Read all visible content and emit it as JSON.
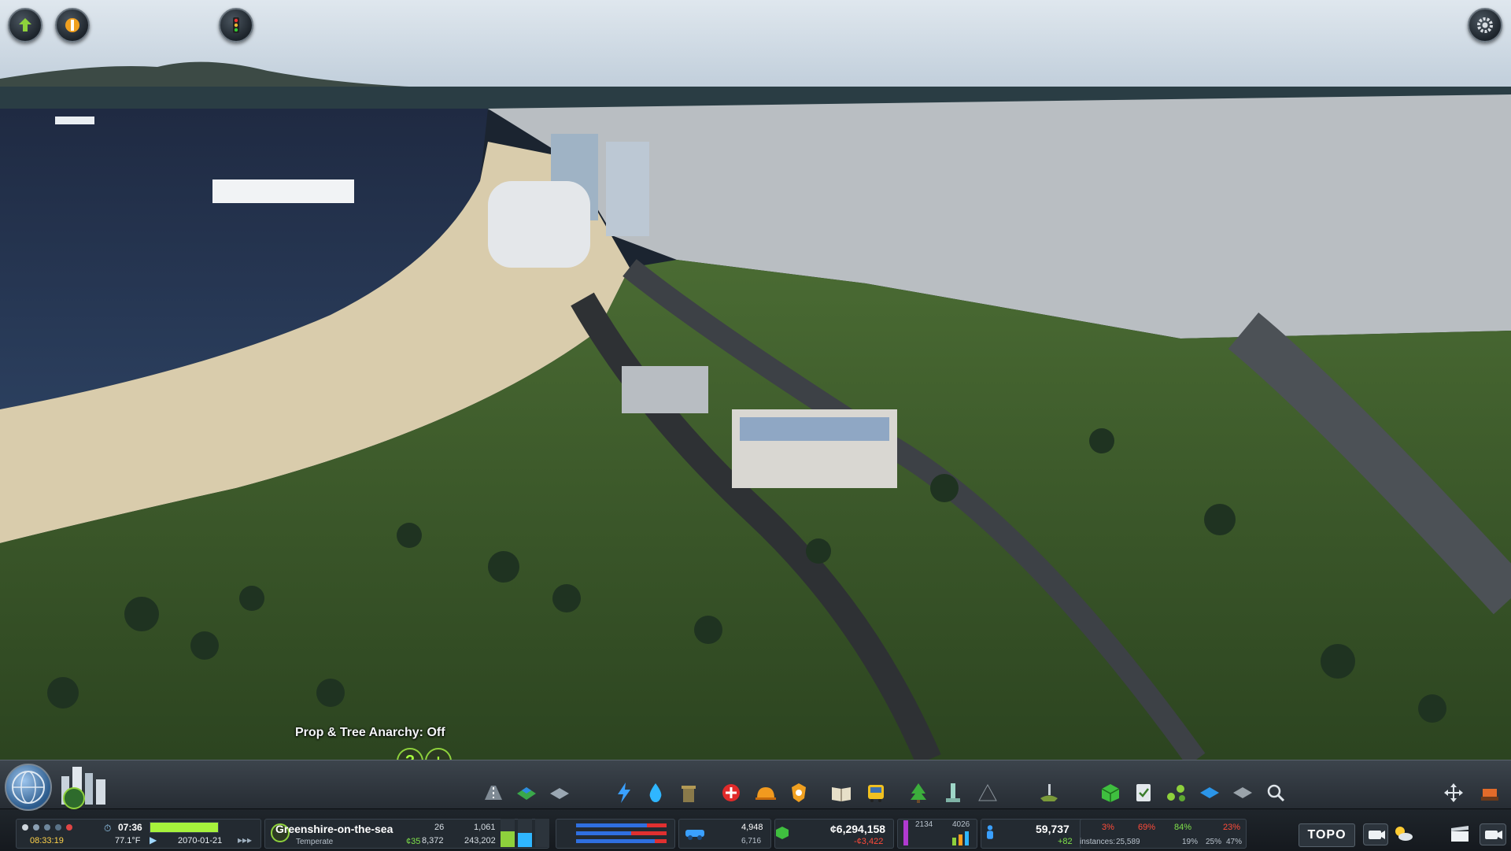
{
  "top_buttons": [
    {
      "name": "unlock-icon"
    },
    {
      "name": "advisor-icon"
    },
    {
      "name": "traffic-light-icon"
    },
    {
      "name": "gear-icon"
    }
  ],
  "overlay": {
    "anarchy_label": "Prop & Tree Anarchy: Off",
    "help_symbol": "?",
    "add_symbol": "+"
  },
  "status": {
    "time": "07:36",
    "temperature": "77.1°F",
    "session_time": "08:33:19",
    "date": "2070-01-21",
    "city_name": "Greenshire-on-the-sea",
    "climate": "Temperate",
    "tile_count": "26",
    "tile_value": "¢35",
    "counts_a": "8,372",
    "counts_b": "1,061",
    "counts_c": "243,202",
    "vehicles": "4,948",
    "vehicles_max": "6,716",
    "money": "¢6,294,158",
    "income": "-¢3,422",
    "bar_value_a": "2134",
    "bar_value_b": "4026",
    "population": "59,737",
    "population_change": "+82",
    "pct_a": "3%",
    "pct_b": "69%",
    "pct_c": "84%",
    "pct_d": "23%",
    "instances_label": "instances:",
    "instances": "25,589",
    "pct_e": "19%",
    "pct_f": "25%",
    "pct_g": "47%",
    "topo": "TOPO"
  },
  "colors": {
    "sky": "#c8d4df",
    "sea": "#26334d",
    "grass": "#3c5a2a",
    "sand": "#d8c9a8",
    "accent_green": "#8ed13c",
    "money_red": "#ff4b3a"
  }
}
